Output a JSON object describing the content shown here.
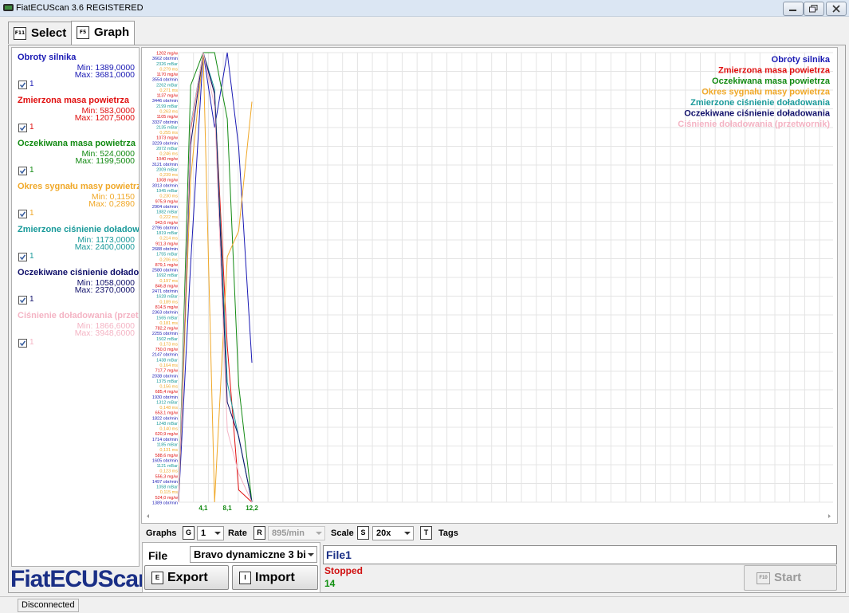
{
  "window": {
    "title": "FiatECUScan 3.6 REGISTERED"
  },
  "tabs": [
    {
      "key": "F11",
      "label": "Select"
    },
    {
      "key": "F5",
      "label": "Graph"
    }
  ],
  "params": [
    {
      "name": "Obroty silnika",
      "min": "Min: 1389,0000",
      "max": "Max: 3681,0000",
      "checked": "1",
      "color": "#1a1ab4"
    },
    {
      "name": "Zmierzona masa powietrza",
      "min": "Min: 583,0000",
      "max": "Max: 1207,5000",
      "checked": "1",
      "color": "#e01010"
    },
    {
      "name": "Oczekiwana masa powietrza",
      "min": "Min: 524,0000",
      "max": "Max: 1199,5000",
      "checked": "1",
      "color": "#128a12"
    },
    {
      "name": "Okres sygnału masy powietrz",
      "min": "Min: 0,1150",
      "max": "Max: 0,2890",
      "checked": "1",
      "color": "#f0a828"
    },
    {
      "name": "Zmierzone ciśnienie doładow",
      "min": "Min: 1173,0000",
      "max": "Max: 2400,0000",
      "checked": "1",
      "color": "#1a9a9a"
    },
    {
      "name": "Oczekiwane ciśnienie dołado",
      "min": "Min: 1058,0000",
      "max": "Max: 2370,0000",
      "checked": "1",
      "color": "#10106a"
    },
    {
      "name": "Ciśnienie doładowania (przet",
      "min": "Min: 1866,6000",
      "max": "Max: 3948,6000",
      "checked": "1",
      "color": "#f4b4c4"
    }
  ],
  "logo": "FiatECUScan",
  "chart_data": {
    "type": "line",
    "title": "",
    "xlabel": "",
    "ylabel": "",
    "x_ticks": [
      "4,1",
      "8,1",
      "12,2"
    ],
    "legend_position": "top-right",
    "grid": true,
    "series": [
      {
        "name": "Obroty silnika",
        "color": "#1a1ab4",
        "x": [
          0,
          2,
          4.1,
          6,
          8.1,
          10,
          12.2
        ],
        "y": [
          1389,
          2600,
          3681,
          3300,
          3681,
          3200,
          2100
        ]
      },
      {
        "name": "Zmierzona masa powietrza",
        "color": "#e01010",
        "x": [
          0,
          2,
          4.1,
          6,
          8.1,
          10,
          12.2
        ],
        "y": [
          583,
          1100,
          1207.5,
          1150,
          800,
          600,
          583
        ]
      },
      {
        "name": "Oczekiwana masa powietrza",
        "color": "#128a12",
        "x": [
          0,
          2,
          4.1,
          6,
          8.1,
          10,
          12.2
        ],
        "y": [
          524,
          1150,
          1199.5,
          1199.5,
          1100,
          700,
          524
        ]
      },
      {
        "name": "Okres sygnału masy powietrza",
        "color": "#f0a828",
        "x": [
          0,
          2,
          4.1,
          6,
          8.1,
          10,
          12.2
        ],
        "y": [
          0.115,
          0.24,
          0.289,
          0.115,
          0.21,
          0.22,
          0.27
        ]
      },
      {
        "name": "Zmierzone ciśnienie doładowania",
        "color": "#1a9a9a",
        "x": [
          0,
          2,
          4.1,
          6,
          8.1,
          10,
          12.2
        ],
        "y": [
          1173,
          2200,
          2400,
          2300,
          1500,
          1350,
          1173
        ]
      },
      {
        "name": "Oczekiwane ciśnienie doładowania",
        "color": "#10106a",
        "x": [
          0,
          2,
          4.1,
          6,
          8.1,
          10,
          12.2
        ],
        "y": [
          1058,
          2100,
          2370,
          2250,
          1350,
          1250,
          1058
        ]
      },
      {
        "name": "Ciśnienie doładowania (przetwornik)",
        "color": "#f4b4c4",
        "x": [
          0,
          2,
          4.1,
          6,
          8.1,
          10,
          12.2
        ],
        "y": [
          1866.6,
          3600,
          3948.6,
          3700,
          2200,
          2000,
          1866.6
        ]
      }
    ],
    "y_labels": [
      "1202 mg/w",
      "3662 obr/min",
      "2326 mBar",
      "0,279 ms",
      "1170 mg/w",
      "3554 obr/min",
      "2262 mBar",
      "0,271 ms",
      "1137 mg/w",
      "3446 obr/min",
      "2199 mBar",
      "0,263 ms",
      "1105 mg/w",
      "3337 obr/min",
      "2135 mBar",
      "0,255 ms",
      "1073 mg/w",
      "3229 obr/min",
      "2072 mBar",
      "0,246 ms",
      "1040 mg/w",
      "3121 obr/min",
      "2009 mBar",
      "0,239 ms",
      "1008 mg/w",
      "3013 obr/min",
      "1945 mBar",
      "0,230 ms",
      "975,9 mg/w",
      "2904 obr/min",
      "1882 mBar",
      "0,222 ms",
      "943,6 mg/w",
      "2796 obr/min",
      "1819 mBar",
      "0,214 ms",
      "911,3 mg/w",
      "2688 obr/min",
      "1755 mBar",
      "0,206 ms",
      "879,1 mg/w",
      "2580 obr/min",
      "1692 mBar",
      "0,197 ms",
      "846,8 mg/w",
      "2471 obr/min",
      "1628 mBar",
      "0,189 ms",
      "814,5 mg/w",
      "2363 obr/min",
      "1565 mBar",
      "0,181 ms",
      "782,2 mg/w",
      "2255 obr/min",
      "1502 mBar",
      "0,173 ms",
      "750,0 mg/w",
      "2147 obr/min",
      "1438 mBar",
      "0,164 ms",
      "717,7 mg/w",
      "2038 obr/min",
      "1375 mBar",
      "0,156 ms",
      "685,4 mg/w",
      "1930 obr/min",
      "1312 mBar",
      "0,148 ms",
      "653,1 mg/w",
      "1822 obr/min",
      "1248 mBar",
      "0,140 ms",
      "620,9 mg/w",
      "1714 obr/min",
      "1185 mBar",
      "0,131 ms",
      "588,6 mg/w",
      "1605 obr/min",
      "1121 mBar",
      "0,123 ms",
      "556,3 mg/w",
      "1497 obr/min",
      "1058 mBar",
      "0,115 ms",
      "524,0 mg/w",
      "1389 obr/min"
    ]
  },
  "controls": {
    "graphs_label": "Graphs",
    "graphs_key": "G",
    "graphs_value": "1",
    "rate_label": "Rate",
    "rate_key": "R",
    "rate_value": "895/min",
    "scale_label": "Scale",
    "scale_key": "S",
    "scale_value": "20x",
    "tags_key": "T",
    "tags_label": "Tags"
  },
  "file": {
    "label": "File",
    "selected": "Bravo dynamiczne 3 bi",
    "export_key": "E",
    "export_label": "Export",
    "import_key": "I",
    "import_label": "Import",
    "info": "File1",
    "status": "Stopped",
    "count": "14",
    "start_key": "F10",
    "start_label": "Start"
  },
  "statusbar": {
    "connection": "Disconnected"
  }
}
